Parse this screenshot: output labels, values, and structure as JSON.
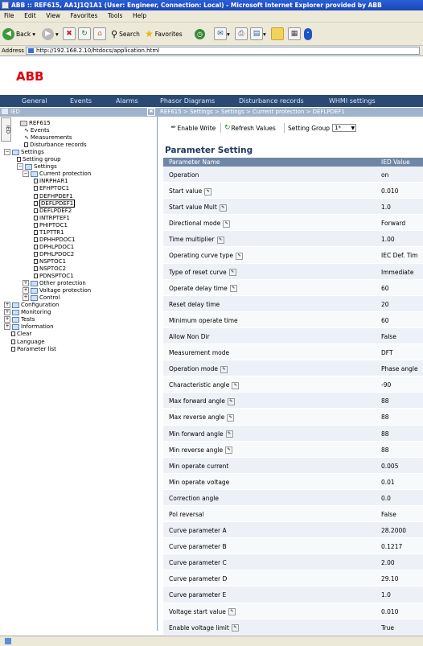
{
  "window": {
    "title": "ABB :: REF615, AA1J1Q1A1 (User: Engineer, Connection: Local) - Microsoft Internet Explorer provided by ABB"
  },
  "menubar": {
    "items": [
      "File",
      "Edit",
      "View",
      "Favorites",
      "Tools",
      "Help"
    ]
  },
  "toolbar": {
    "back_label": "Back",
    "search_label": "Search",
    "favorites_label": "Favorites"
  },
  "address": {
    "label": "Address",
    "url": "http://192.168.2.10/htdocs/application.html"
  },
  "logo": {
    "text": "ABB"
  },
  "nav": {
    "items": [
      "General",
      "Events",
      "Alarms",
      "Phasor Diagrams",
      "Disturbance records",
      "WHMI settings"
    ]
  },
  "left_panel": {
    "title": "IED",
    "vertical_tab": "IED",
    "tree": [
      {
        "label": "REF615",
        "icon": "device-icon"
      },
      {
        "label": "Events",
        "icon": "wave-icon"
      },
      {
        "label": "Measurements",
        "icon": "wave-icon"
      },
      {
        "label": "Disturbance records",
        "icon": "node-icon"
      },
      {
        "label": "Settings",
        "icon": "folder-icon"
      },
      {
        "label": "Setting group",
        "icon": "node-icon"
      },
      {
        "label": "Settings",
        "icon": "folder-icon"
      },
      {
        "label": "Current protection",
        "icon": "folder-icon"
      },
      {
        "label": "INRPHAR1",
        "icon": "node-icon"
      },
      {
        "label": "EFHPTOC1",
        "icon": "node-icon"
      },
      {
        "label": "DEFHPDEF1",
        "icon": "node-icon"
      },
      {
        "label": "DEFLPDEF1",
        "icon": "node-icon"
      },
      {
        "label": "DEFLPDEF2",
        "icon": "node-icon"
      },
      {
        "label": "INTRPTEF1",
        "icon": "node-icon"
      },
      {
        "label": "PHIPTOC1",
        "icon": "node-icon"
      },
      {
        "label": "T1PTTR1",
        "icon": "node-icon"
      },
      {
        "label": "DPHHPDOC1",
        "icon": "node-icon"
      },
      {
        "label": "DPHLPDOC1",
        "icon": "node-icon"
      },
      {
        "label": "DPHLPDOC2",
        "icon": "node-icon"
      },
      {
        "label": "NSPTOC1",
        "icon": "node-icon"
      },
      {
        "label": "NSPTOC2",
        "icon": "node-icon"
      },
      {
        "label": "PDNSPTOC1",
        "icon": "node-icon"
      },
      {
        "label": "Other protection",
        "icon": "folder-icon"
      },
      {
        "label": "Voltage protection",
        "icon": "folder-icon"
      },
      {
        "label": "Control",
        "icon": "folder-icon"
      },
      {
        "label": "Configuration",
        "icon": "folder-icon"
      },
      {
        "label": "Monitoring",
        "icon": "folder-icon"
      },
      {
        "label": "Tests",
        "icon": "folder-icon"
      },
      {
        "label": "Information",
        "icon": "folder-icon"
      },
      {
        "label": "Clear",
        "icon": "node-icon"
      },
      {
        "label": "Language",
        "icon": "node-icon"
      },
      {
        "label": "Parameter list",
        "icon": "node-icon"
      }
    ]
  },
  "breadcrumb": "REF615 > Settings > Settings > Current protection > DEFLPDEF1",
  "actions": {
    "enable_write": "Enable Write",
    "refresh_values": "Refresh Values",
    "setting_group_label": "Setting Group",
    "setting_group_value": "1*"
  },
  "parameters": {
    "title": "Parameter Setting",
    "col_name": "Parameter Name",
    "col_value": "IED Value",
    "rows": [
      {
        "name": "Operation",
        "value": "on",
        "hint": false
      },
      {
        "name": "Start value",
        "value": "0.010",
        "hint": true
      },
      {
        "name": "Start value Mult",
        "value": "1.0",
        "hint": true
      },
      {
        "name": "Directional mode",
        "value": "Forward",
        "hint": true
      },
      {
        "name": "Time multiplier",
        "value": "1.00",
        "hint": true
      },
      {
        "name": "Operating curve type",
        "value": "IEC Def. Tim",
        "hint": true
      },
      {
        "name": "Type of reset curve",
        "value": "Immediate",
        "hint": true
      },
      {
        "name": "Operate delay time",
        "value": "60",
        "hint": true
      },
      {
        "name": "Reset delay time",
        "value": "20",
        "hint": false
      },
      {
        "name": "Minimum operate time",
        "value": "60",
        "hint": false
      },
      {
        "name": "Allow Non Dir",
        "value": "False",
        "hint": false
      },
      {
        "name": "Measurement mode",
        "value": "DFT",
        "hint": false
      },
      {
        "name": "Operation mode",
        "value": "Phase angle",
        "hint": true
      },
      {
        "name": "Characteristic angle",
        "value": "-90",
        "hint": true
      },
      {
        "name": "Max forward angle",
        "value": "88",
        "hint": true
      },
      {
        "name": "Max reverse angle",
        "value": "88",
        "hint": true
      },
      {
        "name": "Min forward angle",
        "value": "88",
        "hint": true
      },
      {
        "name": "Min reverse angle",
        "value": "88",
        "hint": true
      },
      {
        "name": "Min operate current",
        "value": "0.005",
        "hint": false
      },
      {
        "name": "Min operate voltage",
        "value": "0.01",
        "hint": false
      },
      {
        "name": "Correction angle",
        "value": "0.0",
        "hint": false
      },
      {
        "name": "Pol reversal",
        "value": "False",
        "hint": false
      },
      {
        "name": "Curve parameter A",
        "value": "28.2000",
        "hint": false
      },
      {
        "name": "Curve parameter B",
        "value": "0.1217",
        "hint": false
      },
      {
        "name": "Curve parameter C",
        "value": "2.00",
        "hint": false
      },
      {
        "name": "Curve parameter D",
        "value": "29.10",
        "hint": false
      },
      {
        "name": "Curve parameter E",
        "value": "1.0",
        "hint": false
      },
      {
        "name": "Voltage start value",
        "value": "0.010",
        "hint": true
      },
      {
        "name": "Enable voltage limit",
        "value": "True",
        "hint": true
      }
    ]
  },
  "colors": {
    "title_bar": "#1a46b8",
    "nav_bar": "#2b4a73",
    "abb_red": "#e2000f",
    "table_header": "#6f87a7"
  }
}
